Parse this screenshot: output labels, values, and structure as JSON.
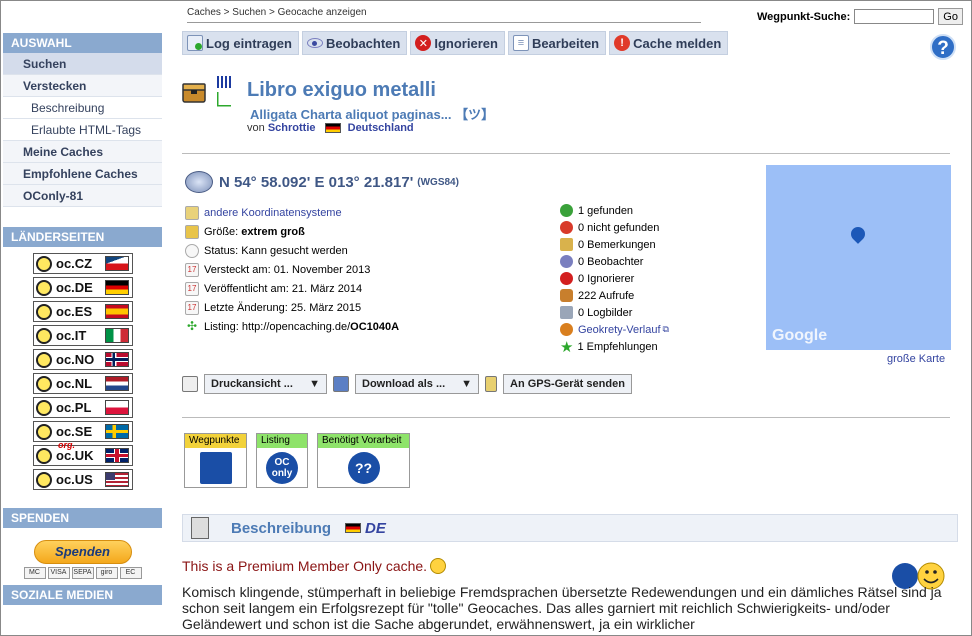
{
  "breadcrumb": "Caches > Suchen > Geocache anzeigen",
  "waypoint_search": {
    "label": "Wegpunkt-Suche:",
    "value": "",
    "go": "Go"
  },
  "toolbar": [
    {
      "label": "Log eintragen",
      "icon": "log-icon"
    },
    {
      "label": "Beobachten",
      "icon": "eye-icon"
    },
    {
      "label": "Ignorieren",
      "icon": "ignore-icon"
    },
    {
      "label": "Bearbeiten",
      "icon": "edit-icon"
    },
    {
      "label": "Cache melden",
      "icon": "report-icon"
    }
  ],
  "help": "?",
  "sidebar": {
    "auswahl": "AUSWAHL",
    "items": [
      {
        "label": "Suchen"
      },
      {
        "label": "Verstecken"
      },
      {
        "label": "Beschreibung"
      },
      {
        "label": "Erlaubte HTML-Tags"
      },
      {
        "label": "Meine Caches"
      },
      {
        "label": "Empfohlene Caches"
      },
      {
        "label": "OConly-81"
      }
    ],
    "laender": "LÄNDERSEITEN",
    "countries": [
      {
        "label": "oc.CZ"
      },
      {
        "label": "oc.DE"
      },
      {
        "label": "oc.ES"
      },
      {
        "label": "oc.IT"
      },
      {
        "label": "oc.NO"
      },
      {
        "label": "oc.NL"
      },
      {
        "label": "oc.PL"
      },
      {
        "label": "oc.SE"
      },
      {
        "label": "oc.UK"
      },
      {
        "label": "oc.US"
      }
    ],
    "uk_org": "org.",
    "spenden": "SPENDEN",
    "paypal": "Spenden",
    "cards": [
      "MC",
      "VISA",
      "SEPA",
      "giro",
      "EC"
    ],
    "soziale": "SOZIALE MEDIEN"
  },
  "cache": {
    "title": "Libro exiguo metalli",
    "subtitle": "Alligata Charta aliquot paginas... 【ツ】",
    "by": "von",
    "owner": "Schrottie",
    "country": "Deutschland",
    "coordinates": "N 54° 58.092' E 013° 21.817'",
    "datum": "(WGS84)",
    "details": {
      "other_coords": "andere Koordinatensysteme",
      "size_label": "Größe:",
      "size_value": "extrem groß",
      "status": "Status: Kann gesucht werden",
      "hidden": "Versteckt am: 01. November 2013",
      "published": "Veröffentlicht am: 21. März 2014",
      "changed": "Letzte Änderung: 25. März 2015",
      "listing_prefix": "Listing: http://opencaching.de/",
      "listing_code": "OC1040A"
    },
    "stats": [
      {
        "text": "1 gefunden",
        "color": "#3aa13a"
      },
      {
        "text": "0 nicht gefunden",
        "color": "#d83a2a"
      },
      {
        "text": "0 Bemerkungen",
        "color": "#d9b24c"
      },
      {
        "text": "0 Beobachter",
        "color": "#7a7fbf"
      },
      {
        "text": "0 Ignorierer",
        "color": "#d31f1f"
      },
      {
        "text": "222 Aufrufe",
        "color": "#c87f2d"
      },
      {
        "text": "0 Logbilder",
        "color": "#9aa6b8"
      }
    ],
    "geokrety": "Geokrety-Verlauf",
    "recommendations": "1 Empfehlungen",
    "bigmap": "große Karte",
    "google": "Google"
  },
  "actions": {
    "print": "Druckansicht ...",
    "download": "Download als ...",
    "gps": "An GPS-Gerät senden"
  },
  "attributes": [
    {
      "label": "Wegpunkte",
      "color": "#f2d23a"
    },
    {
      "label": "Listing",
      "color": "#8ee36a"
    },
    {
      "label": "Benötigt Vorarbeit",
      "color": "#8ee36a"
    }
  ],
  "attribute_oc": "OC",
  "attribute_only": "only",
  "attribute_qq": "??",
  "description": {
    "heading": "Beschreibung",
    "lang": "DE",
    "premium": "This is a Premium Member Only cache.",
    "text": "Komisch klingende, stümperhaft in beliebige Fremdsprachen übersetzte Redewendungen und ein dämliches Rätsel sind ja schon seit langem ein Erfolgsrezept für \"tolle\" Geocaches. Das alles garniert mit reichlich Schwierigkeits- und/oder Geländewert und schon ist die Sache abgerundet, erwähnenswert, ja ein wirklicher"
  }
}
